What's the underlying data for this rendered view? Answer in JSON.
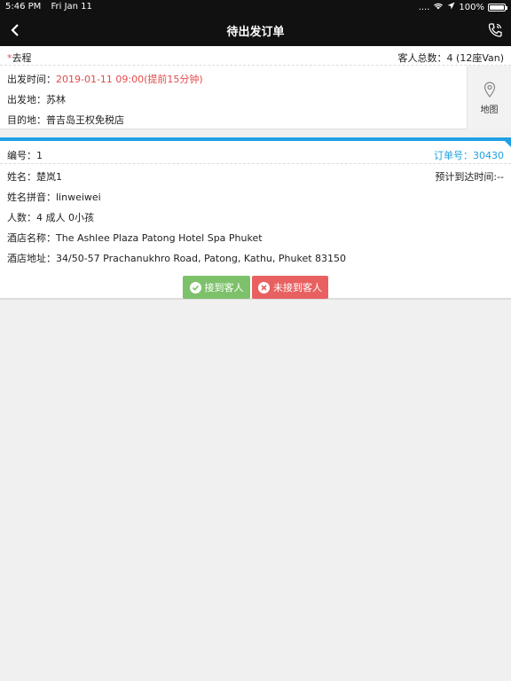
{
  "status_bar": {
    "time": "5:46 PM",
    "date": "Fri Jan 11",
    "signal": "....",
    "battery": "100%",
    "battery_level": 1.0
  },
  "nav": {
    "title": "待出发订单"
  },
  "trip": {
    "direction": "去程",
    "direction_mark": "*",
    "guest_total_label": "客人总数：",
    "guest_total_value": "4 (12座Van)",
    "depart_time_label": "出发时间：",
    "depart_time_value": "2019-01-11 09:00(提前15分钟)",
    "origin_label": "出发地：",
    "origin_value": "苏林",
    "destination_label": "目的地：",
    "destination_value": "普吉岛王权免税店",
    "map_label": "地图"
  },
  "order": {
    "number_label": "编号：",
    "number_value": "1",
    "order_no_label": "订单号：",
    "order_no_value": "30430",
    "name_label": "姓名：",
    "name_value": "楚岚1",
    "eta_label": "预计到达时间:",
    "eta_value": "--",
    "pinyin_label": "姓名拼音：",
    "pinyin_value": "linweiwei",
    "people_label": "人数：",
    "people_value": "4 成人 0小孩",
    "hotel_label": "酒店名称：",
    "hotel_value": "The Ashlee Plaza Patong Hotel Spa Phuket",
    "address_label": "酒店地址：",
    "address_value": "34/50-57 Prachanukhro Road, Patong, Kathu, Phuket 83150"
  },
  "buttons": {
    "picked_up": "接到客人",
    "not_picked_up": "未接到客人"
  },
  "colors": {
    "accent_blue": "#1ea0e3",
    "alert_red": "#e24b4b",
    "green": "#7dc16a",
    "red_button": "#e86060"
  }
}
